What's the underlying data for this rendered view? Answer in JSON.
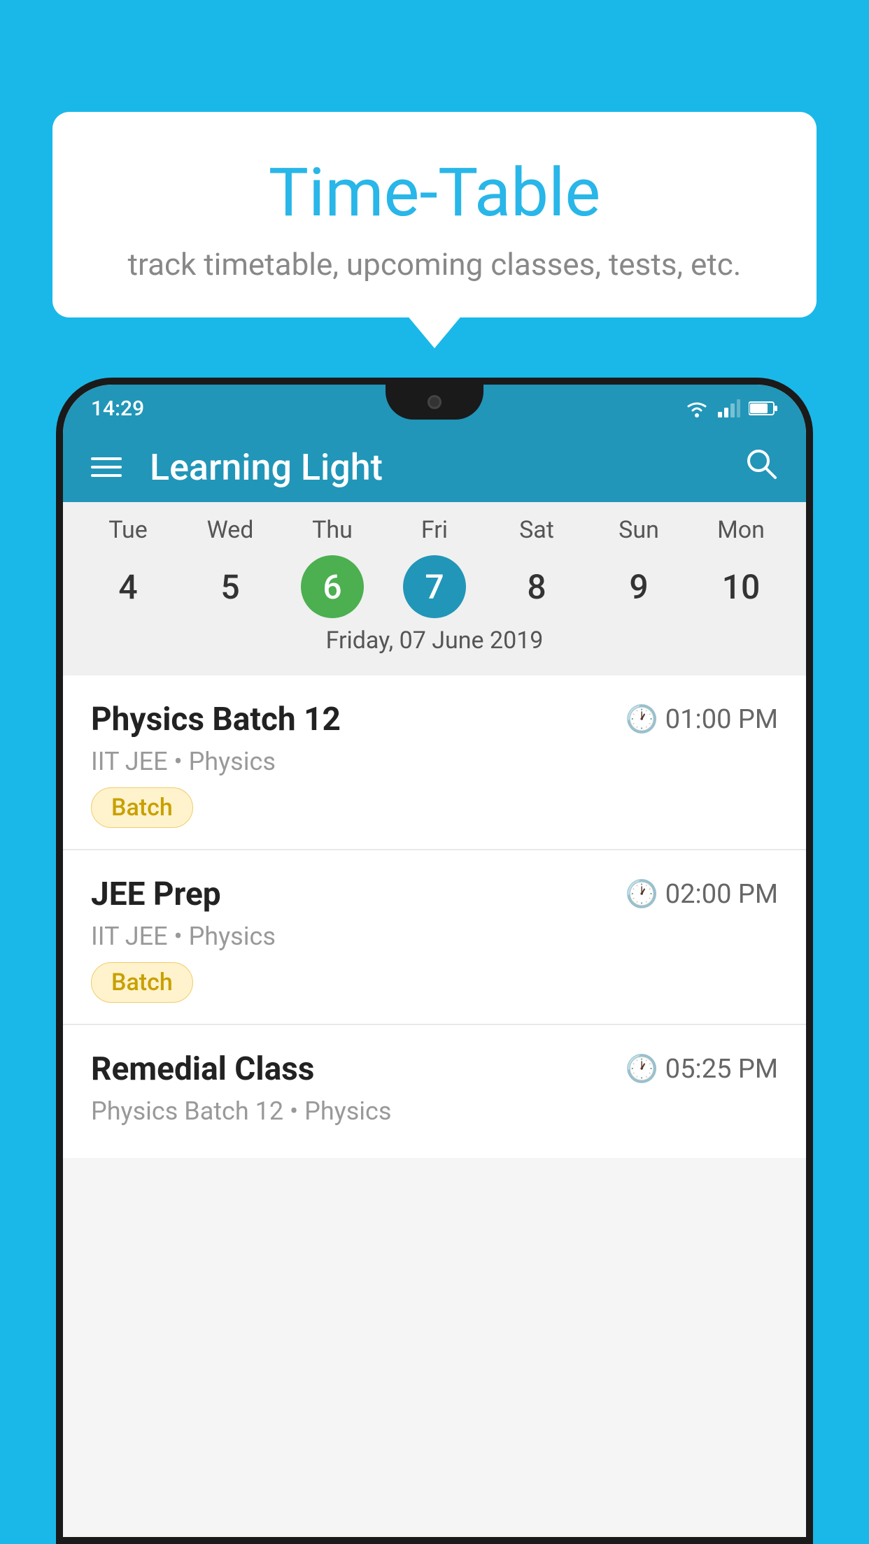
{
  "background": {
    "color": "#1ab8e8"
  },
  "bubble": {
    "title": "Time-Table",
    "subtitle": "track timetable, upcoming classes, tests, etc."
  },
  "phone": {
    "status_bar": {
      "time": "14:29"
    },
    "app_bar": {
      "title": "Learning Light",
      "search_label": "search"
    },
    "calendar": {
      "days": [
        {
          "label": "Tue",
          "number": "4"
        },
        {
          "label": "Wed",
          "number": "5"
        },
        {
          "label": "Thu",
          "number": "6",
          "state": "today"
        },
        {
          "label": "Fri",
          "number": "7",
          "state": "selected"
        },
        {
          "label": "Sat",
          "number": "8"
        },
        {
          "label": "Sun",
          "number": "9"
        },
        {
          "label": "Mon",
          "number": "10"
        }
      ],
      "selected_date": "Friday, 07 June 2019"
    },
    "schedule": [
      {
        "title": "Physics Batch 12",
        "time": "01:00 PM",
        "subtitle": "IIT JEE • Physics",
        "badge": "Batch"
      },
      {
        "title": "JEE Prep",
        "time": "02:00 PM",
        "subtitle": "IIT JEE • Physics",
        "badge": "Batch"
      },
      {
        "title": "Remedial Class",
        "time": "05:25 PM",
        "subtitle": "Physics Batch 12 • Physics",
        "badge": ""
      }
    ]
  }
}
